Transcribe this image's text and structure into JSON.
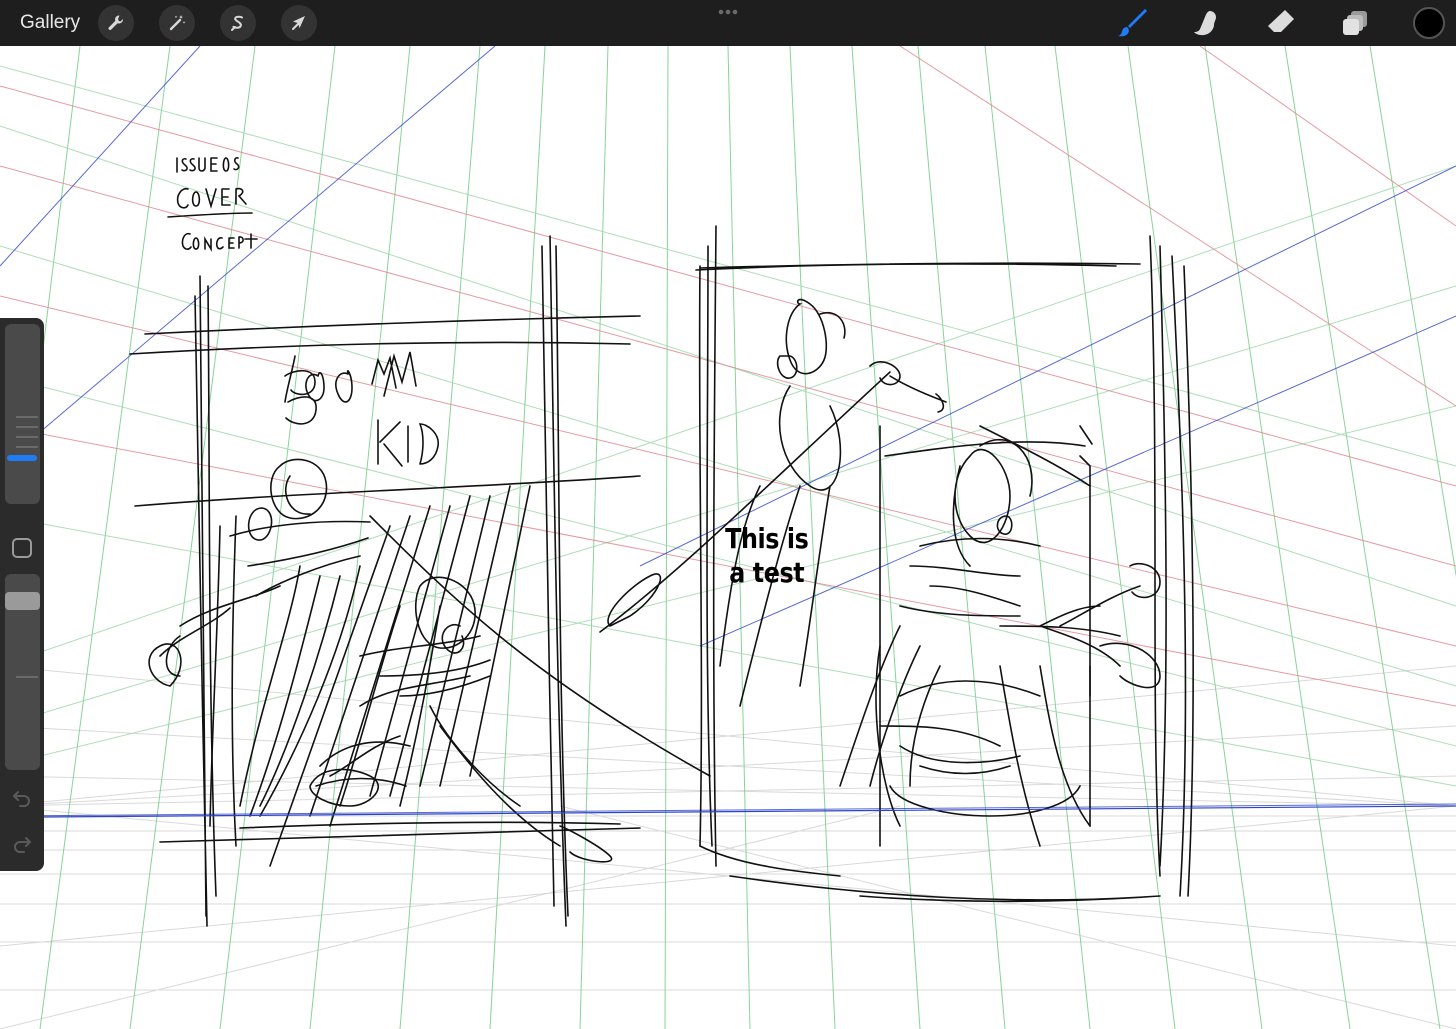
{
  "toolbar": {
    "gallery_label": "Gallery",
    "left_tools": [
      {
        "name": "actions",
        "icon": "wrench-icon"
      },
      {
        "name": "adjustments",
        "icon": "magic-wand-icon"
      },
      {
        "name": "selection",
        "icon": "selection-s-icon"
      },
      {
        "name": "transform",
        "icon": "arrow-cursor-icon"
      }
    ],
    "right_tools": [
      {
        "name": "brush",
        "icon": "brush-icon",
        "active": true
      },
      {
        "name": "smudge",
        "icon": "smudge-finger-icon",
        "active": false
      },
      {
        "name": "eraser",
        "icon": "eraser-icon",
        "active": false
      },
      {
        "name": "layers",
        "icon": "layers-icon",
        "active": false
      }
    ],
    "current_color": "#000000",
    "accent_color": "#1e7cf7"
  },
  "sidebar": {
    "undo_icon": "undo-icon",
    "redo_icon": "redo-icon",
    "modify_icon": "square-modify-icon"
  },
  "canvas": {
    "handwritten_note": [
      "ISSUE 05",
      "COVER",
      "CONCEPT"
    ],
    "sketch_title": [
      "BOOM",
      "KID"
    ],
    "text_layer": "This is a test",
    "guide_colors": {
      "green": "#7ccf8c",
      "red": "#e08a94",
      "blue": "#2d44c8"
    }
  }
}
